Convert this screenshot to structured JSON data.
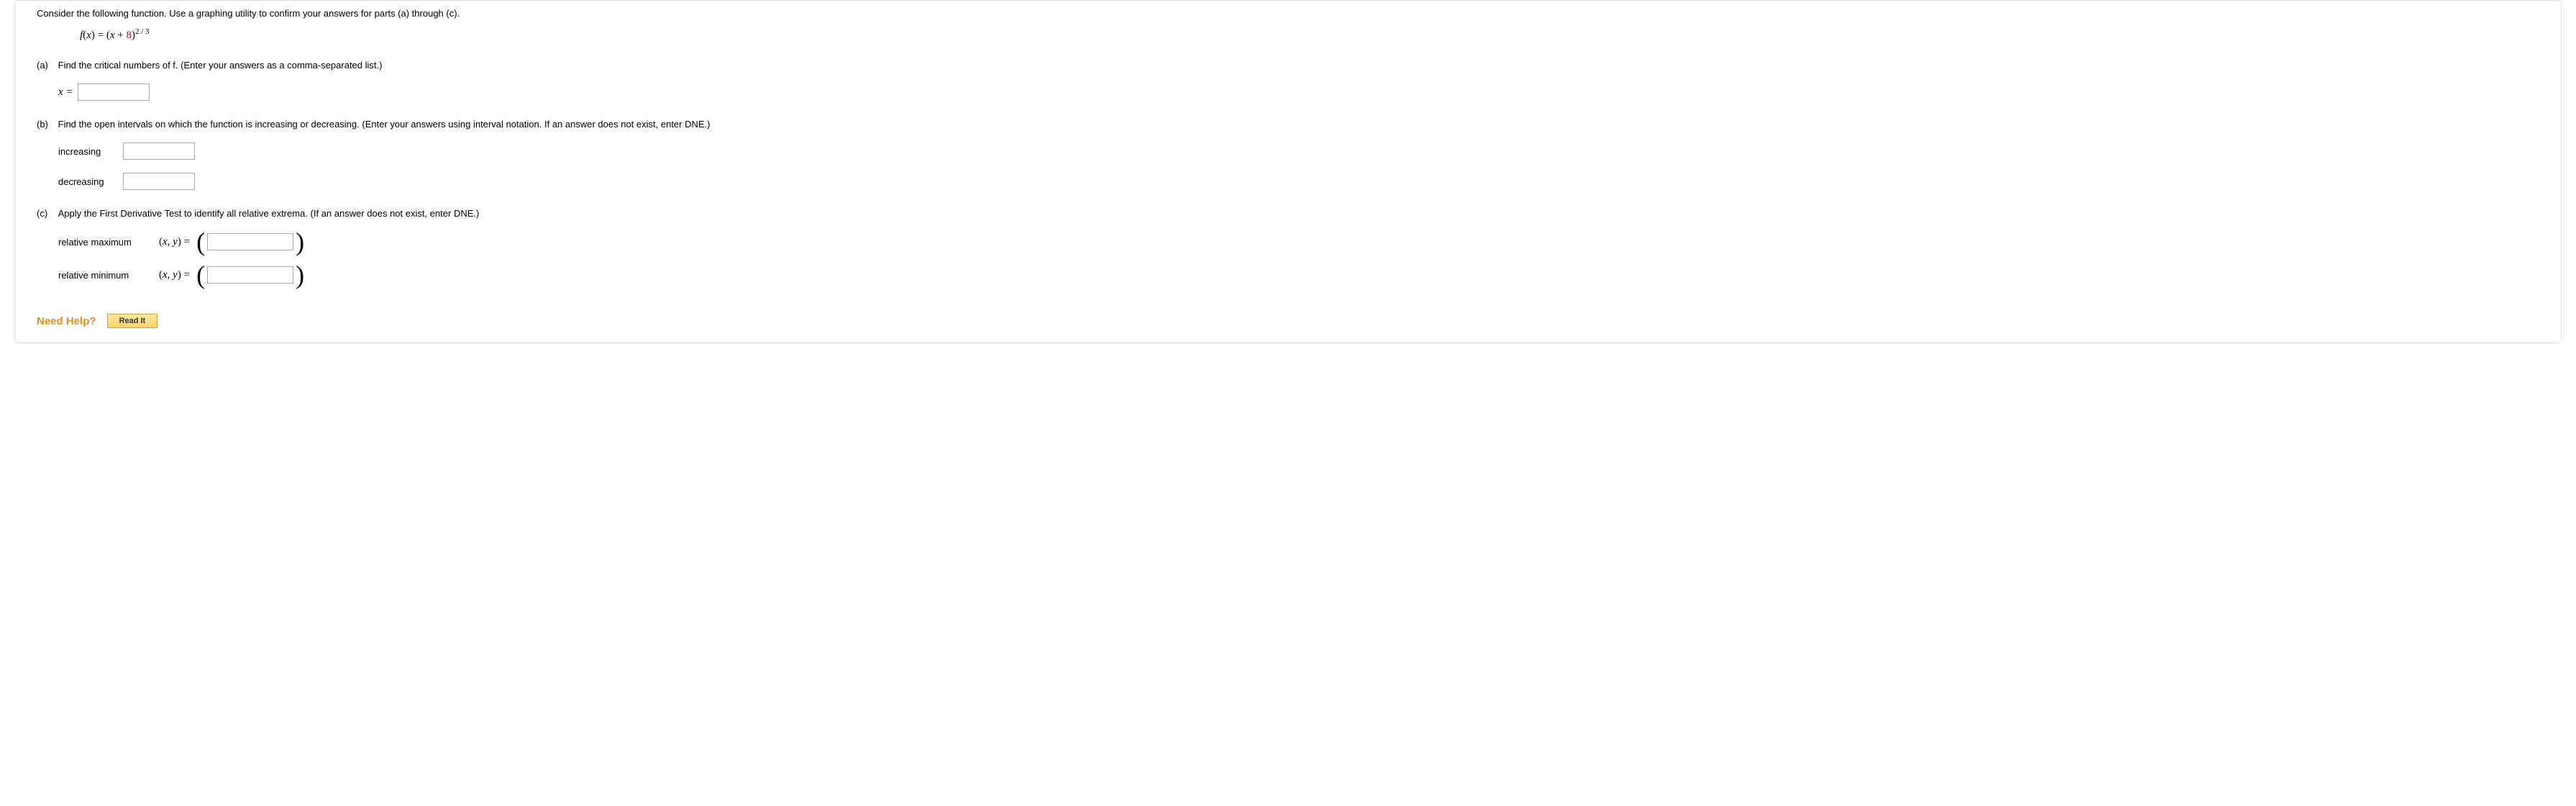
{
  "intro": "Consider the following function. Use a graphing utility to confirm your answers for parts (a) through (c).",
  "func": {
    "lhs_var": "f",
    "lhs_arg": "x",
    "expr_prefix": "(",
    "expr_var": "x",
    "expr_plus": " + ",
    "expr_const": "8",
    "expr_suffix": ")",
    "exp": "2 / 3"
  },
  "parts": {
    "a": {
      "label": "(a)",
      "text": "Find the critical numbers of f. (Enter your answers as a comma-separated list.)",
      "x_label": "x ="
    },
    "b": {
      "label": "(b)",
      "text": "Find the open intervals on which the function is increasing or decreasing. (Enter your answers using interval notation. If an answer does not exist, enter DNE.)",
      "increasing_label": "increasing",
      "decreasing_label": "decreasing"
    },
    "c": {
      "label": "(c)",
      "text": "Apply the First Derivative Test to identify all relative extrema. (If an answer does not exist, enter DNE.)",
      "relmax_label": "relative maximum",
      "relmin_label": "relative minimum",
      "xy_prefix": "(",
      "xy_x": "x",
      "xy_sep": ", ",
      "xy_y": "y",
      "xy_suffix": ")  ="
    }
  },
  "help": {
    "label": "Need Help?",
    "read_it": "Read It"
  }
}
